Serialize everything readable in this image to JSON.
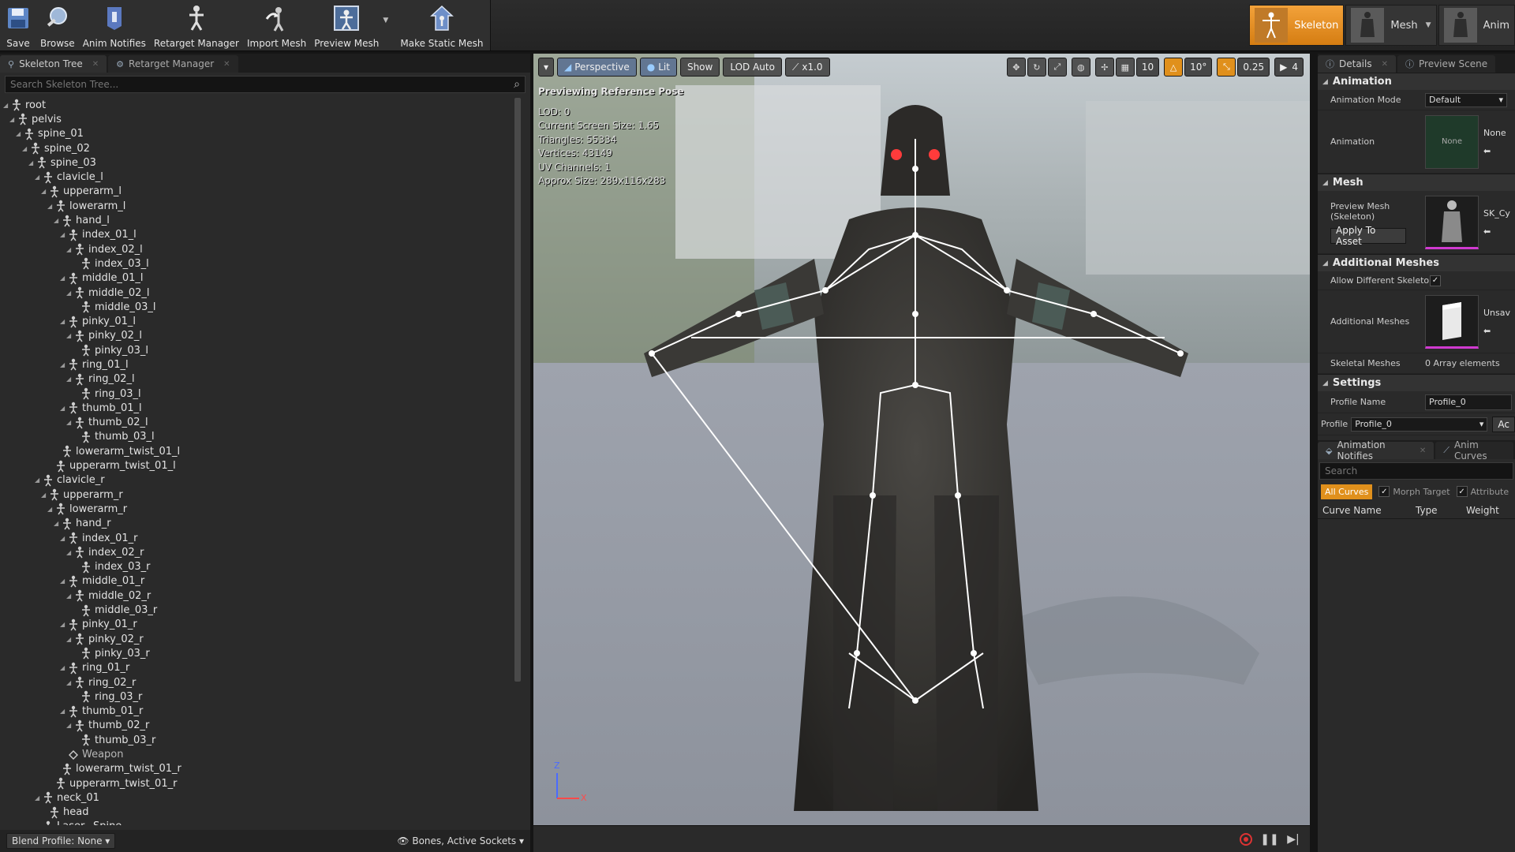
{
  "toolbar": {
    "buttons": [
      {
        "label": "Save",
        "icon": "save-icon"
      },
      {
        "label": "Browse",
        "icon": "browse-icon"
      },
      {
        "label": "Anim Notifies",
        "icon": "anim-notifies-icon"
      },
      {
        "label": "Retarget Manager",
        "icon": "retarget-manager-icon"
      },
      {
        "label": "Import Mesh",
        "icon": "import-mesh-icon"
      },
      {
        "label": "Preview Mesh",
        "icon": "preview-mesh-icon"
      },
      {
        "label": "Make Static Mesh",
        "icon": "make-static-mesh-icon"
      }
    ]
  },
  "modes": [
    {
      "label": "Skeleton",
      "active": true
    },
    {
      "label": "Mesh",
      "active": false
    },
    {
      "label": "Anim",
      "active": false
    }
  ],
  "left_panel": {
    "tabs": [
      {
        "label": "Skeleton Tree",
        "active": true
      },
      {
        "label": "Retarget Manager",
        "active": false
      }
    ],
    "search_placeholder": "Search Skeleton Tree...",
    "tree": [
      {
        "name": "root",
        "depth": 0
      },
      {
        "name": "pelvis",
        "depth": 1
      },
      {
        "name": "spine_01",
        "depth": 2
      },
      {
        "name": "spine_02",
        "depth": 3
      },
      {
        "name": "spine_03",
        "depth": 4
      },
      {
        "name": "clavicle_l",
        "depth": 5
      },
      {
        "name": "upperarm_l",
        "depth": 6
      },
      {
        "name": "lowerarm_l",
        "depth": 7
      },
      {
        "name": "hand_l",
        "depth": 8
      },
      {
        "name": "index_01_l",
        "depth": 9
      },
      {
        "name": "index_02_l",
        "depth": 10
      },
      {
        "name": "index_03_l",
        "depth": 11
      },
      {
        "name": "middle_01_l",
        "depth": 9
      },
      {
        "name": "middle_02_l",
        "depth": 10
      },
      {
        "name": "middle_03_l",
        "depth": 11
      },
      {
        "name": "pinky_01_l",
        "depth": 9
      },
      {
        "name": "pinky_02_l",
        "depth": 10
      },
      {
        "name": "pinky_03_l",
        "depth": 11
      },
      {
        "name": "ring_01_l",
        "depth": 9
      },
      {
        "name": "ring_02_l",
        "depth": 10
      },
      {
        "name": "ring_03_l",
        "depth": 11
      },
      {
        "name": "thumb_01_l",
        "depth": 9
      },
      {
        "name": "thumb_02_l",
        "depth": 10
      },
      {
        "name": "thumb_03_l",
        "depth": 11
      },
      {
        "name": "lowerarm_twist_01_l",
        "depth": 8
      },
      {
        "name": "upperarm_twist_01_l",
        "depth": 7
      },
      {
        "name": "clavicle_r",
        "depth": 5
      },
      {
        "name": "upperarm_r",
        "depth": 6
      },
      {
        "name": "lowerarm_r",
        "depth": 7
      },
      {
        "name": "hand_r",
        "depth": 8
      },
      {
        "name": "index_01_r",
        "depth": 9
      },
      {
        "name": "index_02_r",
        "depth": 10
      },
      {
        "name": "index_03_r",
        "depth": 11
      },
      {
        "name": "middle_01_r",
        "depth": 9
      },
      {
        "name": "middle_02_r",
        "depth": 10
      },
      {
        "name": "middle_03_r",
        "depth": 11
      },
      {
        "name": "pinky_01_r",
        "depth": 9
      },
      {
        "name": "pinky_02_r",
        "depth": 10
      },
      {
        "name": "pinky_03_r",
        "depth": 11
      },
      {
        "name": "ring_01_r",
        "depth": 9
      },
      {
        "name": "ring_02_r",
        "depth": 10
      },
      {
        "name": "ring_03_r",
        "depth": 11
      },
      {
        "name": "thumb_01_r",
        "depth": 9
      },
      {
        "name": "thumb_02_r",
        "depth": 10
      },
      {
        "name": "thumb_03_r",
        "depth": 11
      },
      {
        "name": "Weapon",
        "depth": 9
      },
      {
        "name": "lowerarm_twist_01_r",
        "depth": 8
      },
      {
        "name": "upperarm_twist_01_r",
        "depth": 7
      },
      {
        "name": "neck_01",
        "depth": 5
      },
      {
        "name": "head",
        "depth": 6
      },
      {
        "name": "Laser_ Spine",
        "depth": 5
      }
    ],
    "footer_left": "Blend Profile: None",
    "footer_right": "Bones, Active Sockets"
  },
  "viewport": {
    "buttons": {
      "perspective": "Perspective",
      "lit": "Lit",
      "show": "Show",
      "lod": "LOD Auto",
      "speed": "x1.0"
    },
    "right_values": {
      "grid": "10",
      "rotation": "10°",
      "scale": "0.25",
      "camera_speed": "4"
    },
    "overlay_title": "Previewing Reference Pose",
    "stats": [
      "LOD: 0",
      "Current Screen Size: 1.65",
      "Triangles: 55334",
      "Vertices: 43149",
      "UV Channels: 1",
      "Approx Size: 289x116x283"
    ],
    "axis": {
      "x": "X",
      "z": "Z"
    }
  },
  "right_panel": {
    "tabs": [
      "Details",
      "Preview Scene"
    ],
    "animation_section": "Animation",
    "animation_mode_label": "Animation Mode",
    "animation_mode_value": "Default",
    "animation_label": "Animation",
    "animation_thumb": "None",
    "animation_value": "None",
    "mesh_section": "Mesh",
    "preview_mesh_label": "Preview Mesh (Skeleton)",
    "preview_mesh_value": "SK_Cy",
    "apply_button": "Apply To Asset",
    "additional_section": "Additional Meshes",
    "allow_diff_label": "Allow Different Skeleto",
    "additional_meshes_label": "Additional Meshes",
    "additional_value": "Unsav",
    "skeletal_meshes_label": "Skeletal Meshes",
    "skeletal_meshes_value": "0 Array elements",
    "settings_section": "Settings",
    "profile_name_label": "Profile Name",
    "profile_name_value": "Profile_0",
    "profile_label": "Profile",
    "profile_value": "Profile_0",
    "profile_btn": "Ac",
    "bottom_tabs": [
      "Animation Notifies",
      "Anim Curves"
    ],
    "curves_search_placeholder": "Search",
    "filter_all": "All Curves",
    "filter_morph": "Morph Target",
    "filter_attr": "Attribute",
    "columns": [
      "Curve Name",
      "Type",
      "Weight"
    ]
  },
  "colors": {
    "accent": "#e0901c",
    "panel": "#2a2a2a",
    "dark": "#151515"
  }
}
